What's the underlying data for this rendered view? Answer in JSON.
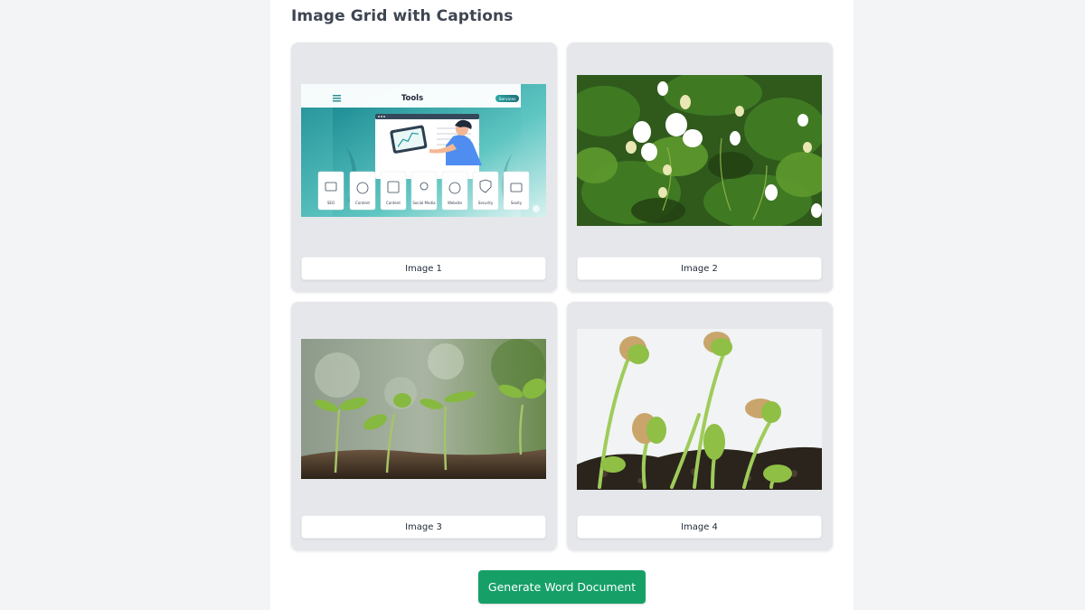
{
  "page": {
    "title": "Image Grid with Captions"
  },
  "grid": {
    "items": [
      {
        "caption": "Image 1",
        "image": {
          "header_title": "Tools",
          "header_badge": "Services",
          "tool_labels": [
            "SEO",
            "Content",
            "Content",
            "Social Media",
            "Website",
            "Security",
            "Sexity"
          ]
        }
      },
      {
        "caption": "Image 2"
      },
      {
        "caption": "Image 3"
      },
      {
        "caption": "Image 4"
      }
    ]
  },
  "actions": {
    "generate_label": "Generate Word Document"
  },
  "colors": {
    "accent": "#16a068",
    "card_bg": "#e5e7eb",
    "page_bg": "#f3f4f6"
  }
}
